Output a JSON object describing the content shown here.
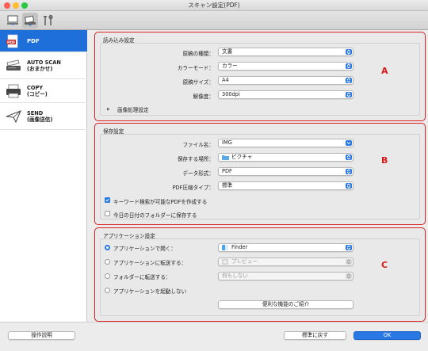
{
  "window": {
    "title": "スキャン設定(PDF)"
  },
  "sidebar": {
    "items": [
      {
        "label": "PDF",
        "icon": "pdf-document-icon",
        "selected": true
      },
      {
        "label": "AUTO SCAN\n(おまかせ)",
        "icon": "scanner-icon",
        "selected": false
      },
      {
        "label": "COPY\n(コピー)",
        "icon": "printer-icon",
        "selected": false
      },
      {
        "label": "SEND\n(画像送信)",
        "icon": "paper-plane-icon",
        "selected": false
      }
    ]
  },
  "read_settings": {
    "title": "読み込み設定",
    "doc_type_label": "原稿の種類：",
    "doc_type_value": "文書",
    "color_mode_label": "カラーモード：",
    "color_mode_value": "カラー",
    "paper_size_label": "原稿サイズ：",
    "paper_size_value": "A4",
    "resolution_label": "解像度：",
    "resolution_value": "300dpi",
    "image_processing_label": "画像処理設定",
    "marker": "A"
  },
  "save_settings": {
    "title": "保存設定",
    "file_name_label": "ファイル名：",
    "file_name_value": "IMG",
    "save_location_label": "保存する場所：",
    "save_location_value": "ピクチャ",
    "data_format_label": "データ形式：",
    "data_format_value": "PDF",
    "compression_label": "PDF圧縮タイプ：",
    "compression_value": "標準",
    "keyword_checkbox_label": "キーワード検索が可能なPDFを作成する",
    "keyword_checked": true,
    "date_folder_label": "今日の日付のフォルダーに保存する",
    "date_folder_checked": false,
    "marker": "B"
  },
  "app_settings": {
    "title": "アプリケーション設定",
    "open_with_label": "アプリケーションで開く：",
    "open_with_value": "Finder",
    "send_to_app_label": "アプリケーションに転送する：",
    "send_to_app_value": "プレビュー",
    "send_to_folder_label": "フォルダーに転送する：",
    "send_to_folder_value": "何もしない",
    "no_launch_label": "アプリケーションを起動しない",
    "selected_option": "open_with",
    "useful_features_button": "便利な機能のご紹介",
    "marker": "C"
  },
  "footer": {
    "instructions_button": "操作説明",
    "defaults_button": "標準に戻す",
    "ok_button": "OK"
  },
  "colors": {
    "accent": "#2a78e4",
    "highlight": "#d91f1f",
    "selected_sidebar": "#1e6fd9"
  }
}
